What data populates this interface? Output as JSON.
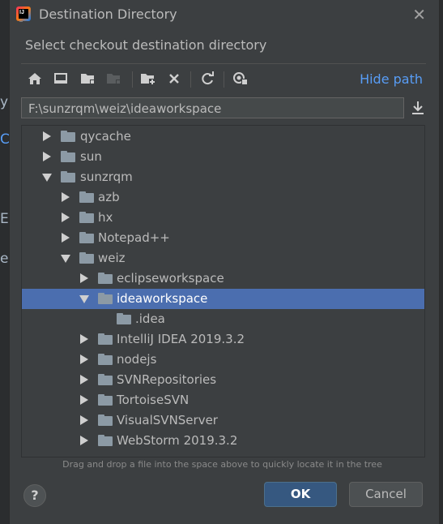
{
  "window": {
    "title": "Destination Directory"
  },
  "dialog": {
    "subtitle": "Select checkout destination directory"
  },
  "behind_text": [
    "y",
    "C",
    "E",
    "e"
  ],
  "toolbar": {
    "buttons": [
      "home-icon",
      "desktop-icon",
      "project-folder-icon",
      "module-folder-icon",
      "new-folder-icon",
      "delete-icon",
      "refresh-icon",
      "show-hidden-icon"
    ],
    "hide_path_label": "Hide path"
  },
  "path_field": {
    "value": "F:\\sunzrqm\\weiz\\ideaworkspace"
  },
  "tree": {
    "rows": [
      {
        "label": "qycache",
        "state": "collapsed"
      },
      {
        "label": "sun",
        "state": "collapsed"
      },
      {
        "label": "sunzrqm",
        "state": "expanded"
      },
      {
        "label": "azb",
        "state": "collapsed"
      },
      {
        "label": "hx",
        "state": "collapsed"
      },
      {
        "label": "Notepad++",
        "state": "collapsed"
      },
      {
        "label": "weiz",
        "state": "expanded"
      },
      {
        "label": "eclipseworkspace",
        "state": "collapsed"
      },
      {
        "label": "ideaworkspace",
        "state": "expanded",
        "selected": true
      },
      {
        "label": ".idea",
        "state": "leaf"
      },
      {
        "label": "IntelliJ IDEA 2019.3.2",
        "state": "collapsed"
      },
      {
        "label": "nodejs",
        "state": "collapsed"
      },
      {
        "label": "SVNRepositories",
        "state": "collapsed"
      },
      {
        "label": "TortoiseSVN",
        "state": "collapsed"
      },
      {
        "label": "VisualSVNServer",
        "state": "collapsed"
      },
      {
        "label": "WebStorm 2019.3.2",
        "state": "collapsed"
      }
    ]
  },
  "hint": "Drag and drop a file into the space above to quickly locate it in the tree",
  "buttons": {
    "help": "?",
    "ok": "OK",
    "cancel": "Cancel"
  },
  "colors": {
    "background": "#3c3f41",
    "selection": "#4b6eaf",
    "link": "#589df6",
    "ok_button": "#365880"
  }
}
